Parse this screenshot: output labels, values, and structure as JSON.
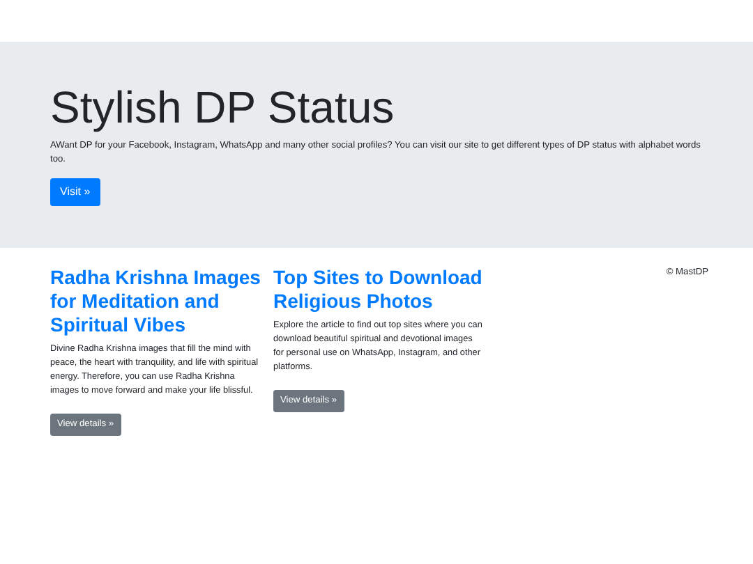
{
  "hero": {
    "title": "Stylish DP Status",
    "text": "AWant DP for your Facebook, Instagram, WhatsApp and many other social profiles? You can visit our site to get different types of DP status with alphabet words too.",
    "button": "Visit »"
  },
  "articles": [
    {
      "title": "Radha Krishna Images for Meditation and Spiritual Vibes",
      "text": "Divine Radha Krishna images that fill the mind with peace, the heart with tranquility, and life with spiritual energy. Therefore, you can use Radha Krishna images to move forward and make your life blissful.",
      "button": "View details »"
    },
    {
      "title": "Top Sites to Download Religious Photos",
      "text": "Explore the article to find out top sites where you can download beautiful spiritual and devotional images for personal use on WhatsApp, Instagram, and other platforms.",
      "button": "View details »"
    }
  ],
  "footer": "© MastDP"
}
